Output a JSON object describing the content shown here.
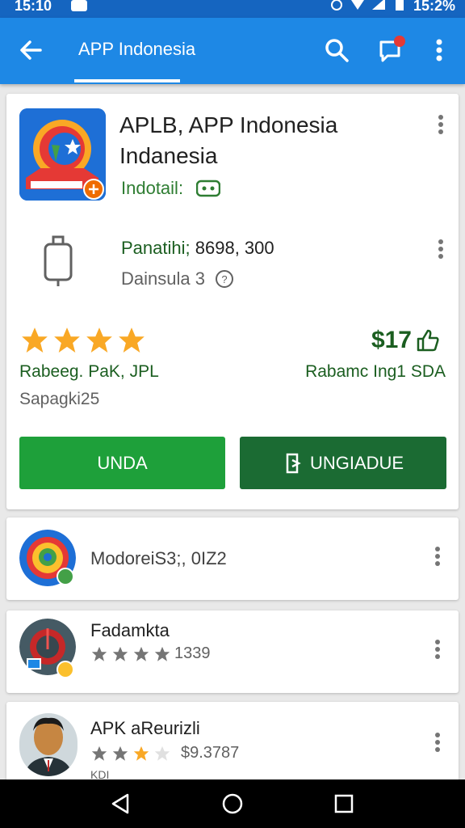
{
  "status_bar": {
    "time": "15:10",
    "battery_text": "15:2%",
    "icons": [
      "notification-icon",
      "alarm-icon",
      "wifi-icon",
      "signal-icon",
      "battery-icon"
    ]
  },
  "app_bar": {
    "title": "APP Indonesia",
    "icons": [
      "back-arrow-icon",
      "search-icon",
      "chat-icon",
      "more-vert-icon"
    ]
  },
  "app_card": {
    "title": "APLB, APP Indonesia Indanesia",
    "subtitle": "Indotail:",
    "price_label": "Panatihi;",
    "price_value": "8698, 300",
    "developer": "Dainsula 3",
    "rating_stars": 4,
    "rating_label": "Rabeeg. PaK, JPL",
    "rating_count": "Sapagki25",
    "price_right": "$17",
    "right_label": "Rabamc Ing1 SDA",
    "install_button": "UNDA",
    "upgrade_button": "UNGIADUE"
  },
  "list_items": [
    {
      "title": "ModoreiS3;, 0IZ2",
      "subtitle": "",
      "stars": null
    },
    {
      "title": "Fadamkta",
      "subtitle": "1339",
      "stars": 4
    },
    {
      "title": "APK aReurizli",
      "subtitle": "$9.3787",
      "stars": 2.5,
      "extra": "KDI"
    }
  ],
  "colors": {
    "status_bar": "#1565c0",
    "app_bar": "#1e88e5",
    "install_green": "#1ea03a",
    "upgrade_green": "#1b6b33",
    "star_orange": "#f9a825"
  }
}
